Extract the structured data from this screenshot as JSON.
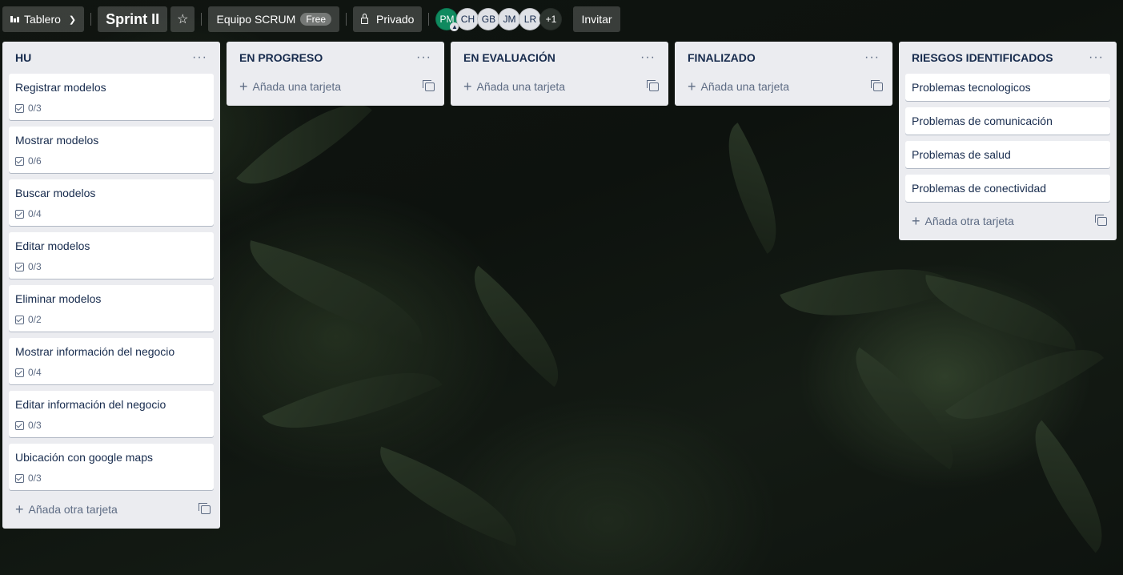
{
  "header": {
    "view_switcher": "Tablero",
    "board_title": "Sprint II",
    "workspace": "Equipo SCRUM",
    "workspace_plan": "Free",
    "visibility": "Privado",
    "members": [
      "PM",
      "CH",
      "GB",
      "JM",
      "LR"
    ],
    "more_members": "+1",
    "invite": "Invitar"
  },
  "lists": [
    {
      "title": "HU",
      "cards": [
        {
          "title": "Registrar modelos",
          "checklist": "0/3"
        },
        {
          "title": "Mostrar modelos",
          "checklist": "0/6"
        },
        {
          "title": "Buscar modelos",
          "checklist": "0/4"
        },
        {
          "title": "Editar modelos",
          "checklist": "0/3"
        },
        {
          "title": "Eliminar modelos",
          "checklist": "0/2"
        },
        {
          "title": "Mostrar información del negocio",
          "checklist": "0/4"
        },
        {
          "title": "Editar información del negocio",
          "checklist": "0/3"
        },
        {
          "title": "Ubicación con google maps",
          "checklist": "0/3"
        }
      ],
      "add_label": "Añada otra tarjeta"
    },
    {
      "title": "EN PROGRESO",
      "cards": [],
      "add_label": "Añada una tarjeta"
    },
    {
      "title": "EN EVALUACIÓN",
      "cards": [],
      "add_label": "Añada una tarjeta"
    },
    {
      "title": "FINALIZADO",
      "cards": [],
      "add_label": "Añada una tarjeta"
    },
    {
      "title": "RIESGOS IDENTIFICADOS",
      "cards": [
        {
          "title": "Problemas tecnologicos"
        },
        {
          "title": "Problemas de comunicación"
        },
        {
          "title": "Problemas de salud"
        },
        {
          "title": "Problemas de conectividad"
        }
      ],
      "add_label": "Añada otra tarjeta"
    }
  ],
  "icons": {
    "view": "board-icon",
    "chevron": "chevron-down-icon",
    "star": "star-icon",
    "lock": "lock-icon",
    "menu": "more-dots-icon",
    "add": "plus-icon",
    "template": "template-icon",
    "checklist": "checklist-icon"
  }
}
